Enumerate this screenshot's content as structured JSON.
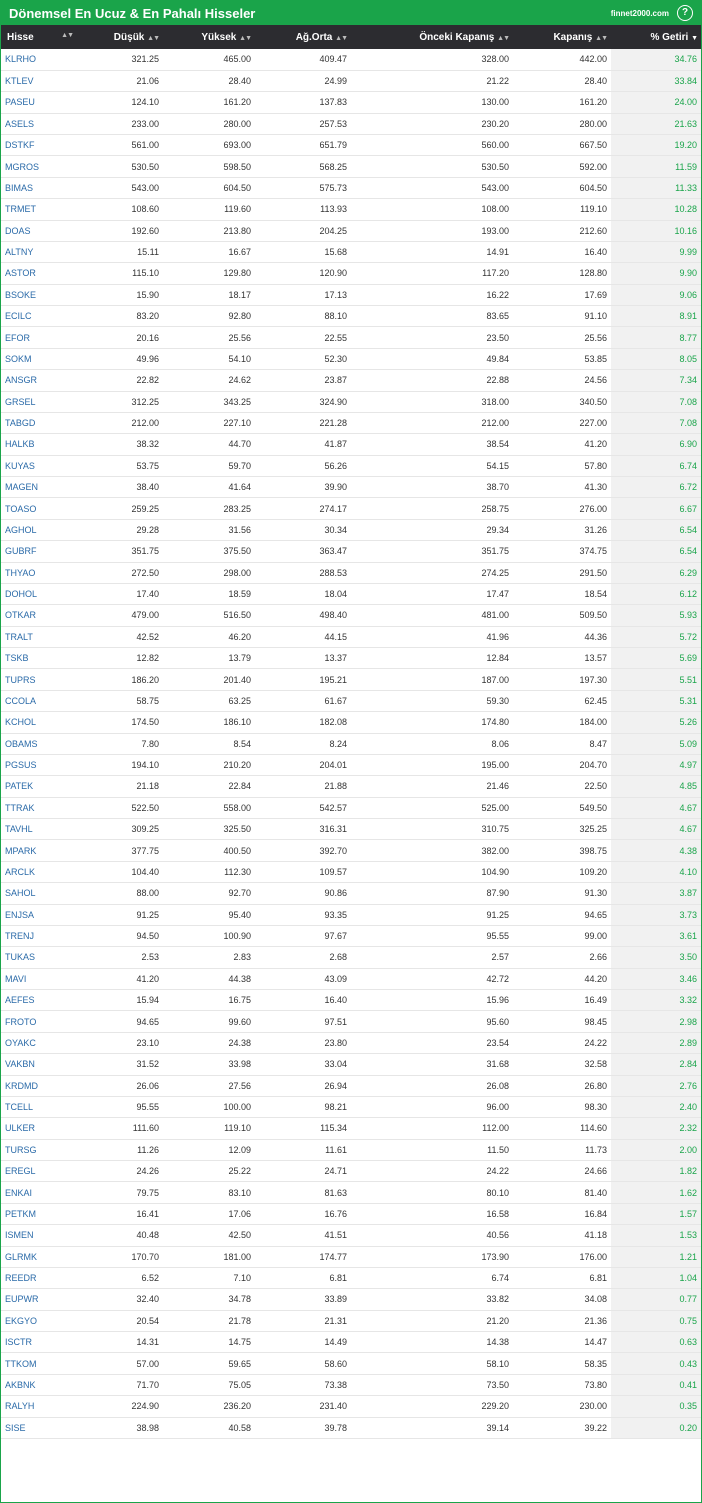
{
  "header": {
    "title": "Dönemsel En Ucuz & En Pahalı Hisseler",
    "brand": "finnet2000.com",
    "help_label": "?"
  },
  "columns": [
    "Hisse",
    "Düşük",
    "Yüksek",
    "Ağ.Orta",
    "Önceki Kapanış",
    "Kapanış",
    "% Getiri"
  ],
  "colors": {
    "accent": "#1aa44a",
    "header_bg": "#2c2c30",
    "link": "#2a6aa8"
  },
  "rows": [
    [
      "KLRHO",
      "321.25",
      "465.00",
      "409.47",
      "328.00",
      "442.00",
      "34.76"
    ],
    [
      "KTLEV",
      "21.06",
      "28.40",
      "24.99",
      "21.22",
      "28.40",
      "33.84"
    ],
    [
      "PASEU",
      "124.10",
      "161.20",
      "137.83",
      "130.00",
      "161.20",
      "24.00"
    ],
    [
      "ASELS",
      "233.00",
      "280.00",
      "257.53",
      "230.20",
      "280.00",
      "21.63"
    ],
    [
      "DSTKF",
      "561.00",
      "693.00",
      "651.79",
      "560.00",
      "667.50",
      "19.20"
    ],
    [
      "MGROS",
      "530.50",
      "598.50",
      "568.25",
      "530.50",
      "592.00",
      "11.59"
    ],
    [
      "BIMAS",
      "543.00",
      "604.50",
      "575.73",
      "543.00",
      "604.50",
      "11.33"
    ],
    [
      "TRMET",
      "108.60",
      "119.60",
      "113.93",
      "108.00",
      "119.10",
      "10.28"
    ],
    [
      "DOAS",
      "192.60",
      "213.80",
      "204.25",
      "193.00",
      "212.60",
      "10.16"
    ],
    [
      "ALTNY",
      "15.11",
      "16.67",
      "15.68",
      "14.91",
      "16.40",
      "9.99"
    ],
    [
      "ASTOR",
      "115.10",
      "129.80",
      "120.90",
      "117.20",
      "128.80",
      "9.90"
    ],
    [
      "BSOKE",
      "15.90",
      "18.17",
      "17.13",
      "16.22",
      "17.69",
      "9.06"
    ],
    [
      "ECILC",
      "83.20",
      "92.80",
      "88.10",
      "83.65",
      "91.10",
      "8.91"
    ],
    [
      "EFOR",
      "20.16",
      "25.56",
      "22.55",
      "23.50",
      "25.56",
      "8.77"
    ],
    [
      "SOKM",
      "49.96",
      "54.10",
      "52.30",
      "49.84",
      "53.85",
      "8.05"
    ],
    [
      "ANSGR",
      "22.82",
      "24.62",
      "23.87",
      "22.88",
      "24.56",
      "7.34"
    ],
    [
      "GRSEL",
      "312.25",
      "343.25",
      "324.90",
      "318.00",
      "340.50",
      "7.08"
    ],
    [
      "TABGD",
      "212.00",
      "227.10",
      "221.28",
      "212.00",
      "227.00",
      "7.08"
    ],
    [
      "HALKB",
      "38.32",
      "44.70",
      "41.87",
      "38.54",
      "41.20",
      "6.90"
    ],
    [
      "KUYAS",
      "53.75",
      "59.70",
      "56.26",
      "54.15",
      "57.80",
      "6.74"
    ],
    [
      "MAGEN",
      "38.40",
      "41.64",
      "39.90",
      "38.70",
      "41.30",
      "6.72"
    ],
    [
      "TOASO",
      "259.25",
      "283.25",
      "274.17",
      "258.75",
      "276.00",
      "6.67"
    ],
    [
      "AGHOL",
      "29.28",
      "31.56",
      "30.34",
      "29.34",
      "31.26",
      "6.54"
    ],
    [
      "GUBRF",
      "351.75",
      "375.50",
      "363.47",
      "351.75",
      "374.75",
      "6.54"
    ],
    [
      "THYAO",
      "272.50",
      "298.00",
      "288.53",
      "274.25",
      "291.50",
      "6.29"
    ],
    [
      "DOHOL",
      "17.40",
      "18.59",
      "18.04",
      "17.47",
      "18.54",
      "6.12"
    ],
    [
      "OTKAR",
      "479.00",
      "516.50",
      "498.40",
      "481.00",
      "509.50",
      "5.93"
    ],
    [
      "TRALT",
      "42.52",
      "46.20",
      "44.15",
      "41.96",
      "44.36",
      "5.72"
    ],
    [
      "TSKB",
      "12.82",
      "13.79",
      "13.37",
      "12.84",
      "13.57",
      "5.69"
    ],
    [
      "TUPRS",
      "186.20",
      "201.40",
      "195.21",
      "187.00",
      "197.30",
      "5.51"
    ],
    [
      "CCOLA",
      "58.75",
      "63.25",
      "61.67",
      "59.30",
      "62.45",
      "5.31"
    ],
    [
      "KCHOL",
      "174.50",
      "186.10",
      "182.08",
      "174.80",
      "184.00",
      "5.26"
    ],
    [
      "OBAMS",
      "7.80",
      "8.54",
      "8.24",
      "8.06",
      "8.47",
      "5.09"
    ],
    [
      "PGSUS",
      "194.10",
      "210.20",
      "204.01",
      "195.00",
      "204.70",
      "4.97"
    ],
    [
      "PATEK",
      "21.18",
      "22.84",
      "21.88",
      "21.46",
      "22.50",
      "4.85"
    ],
    [
      "TTRAK",
      "522.50",
      "558.00",
      "542.57",
      "525.00",
      "549.50",
      "4.67"
    ],
    [
      "TAVHL",
      "309.25",
      "325.50",
      "316.31",
      "310.75",
      "325.25",
      "4.67"
    ],
    [
      "MPARK",
      "377.75",
      "400.50",
      "392.70",
      "382.00",
      "398.75",
      "4.38"
    ],
    [
      "ARCLK",
      "104.40",
      "112.30",
      "109.57",
      "104.90",
      "109.20",
      "4.10"
    ],
    [
      "SAHOL",
      "88.00",
      "92.70",
      "90.86",
      "87.90",
      "91.30",
      "3.87"
    ],
    [
      "ENJSA",
      "91.25",
      "95.40",
      "93.35",
      "91.25",
      "94.65",
      "3.73"
    ],
    [
      "TRENJ",
      "94.50",
      "100.90",
      "97.67",
      "95.55",
      "99.00",
      "3.61"
    ],
    [
      "TUKAS",
      "2.53",
      "2.83",
      "2.68",
      "2.57",
      "2.66",
      "3.50"
    ],
    [
      "MAVI",
      "41.20",
      "44.38",
      "43.09",
      "42.72",
      "44.20",
      "3.46"
    ],
    [
      "AEFES",
      "15.94",
      "16.75",
      "16.40",
      "15.96",
      "16.49",
      "3.32"
    ],
    [
      "FROTO",
      "94.65",
      "99.60",
      "97.51",
      "95.60",
      "98.45",
      "2.98"
    ],
    [
      "OYAKC",
      "23.10",
      "24.38",
      "23.80",
      "23.54",
      "24.22",
      "2.89"
    ],
    [
      "VAKBN",
      "31.52",
      "33.98",
      "33.04",
      "31.68",
      "32.58",
      "2.84"
    ],
    [
      "KRDMD",
      "26.06",
      "27.56",
      "26.94",
      "26.08",
      "26.80",
      "2.76"
    ],
    [
      "TCELL",
      "95.55",
      "100.00",
      "98.21",
      "96.00",
      "98.30",
      "2.40"
    ],
    [
      "ULKER",
      "111.60",
      "119.10",
      "115.34",
      "112.00",
      "114.60",
      "2.32"
    ],
    [
      "TURSG",
      "11.26",
      "12.09",
      "11.61",
      "11.50",
      "11.73",
      "2.00"
    ],
    [
      "EREGL",
      "24.26",
      "25.22",
      "24.71",
      "24.22",
      "24.66",
      "1.82"
    ],
    [
      "ENKAI",
      "79.75",
      "83.10",
      "81.63",
      "80.10",
      "81.40",
      "1.62"
    ],
    [
      "PETKM",
      "16.41",
      "17.06",
      "16.76",
      "16.58",
      "16.84",
      "1.57"
    ],
    [
      "ISMEN",
      "40.48",
      "42.50",
      "41.51",
      "40.56",
      "41.18",
      "1.53"
    ],
    [
      "GLRMK",
      "170.70",
      "181.00",
      "174.77",
      "173.90",
      "176.00",
      "1.21"
    ],
    [
      "REEDR",
      "6.52",
      "7.10",
      "6.81",
      "6.74",
      "6.81",
      "1.04"
    ],
    [
      "EUPWR",
      "32.40",
      "34.78",
      "33.89",
      "33.82",
      "34.08",
      "0.77"
    ],
    [
      "EKGYO",
      "20.54",
      "21.78",
      "21.31",
      "21.20",
      "21.36",
      "0.75"
    ],
    [
      "ISCTR",
      "14.31",
      "14.75",
      "14.49",
      "14.38",
      "14.47",
      "0.63"
    ],
    [
      "TTKOM",
      "57.00",
      "59.65",
      "58.60",
      "58.10",
      "58.35",
      "0.43"
    ],
    [
      "AKBNK",
      "71.70",
      "75.05",
      "73.38",
      "73.50",
      "73.80",
      "0.41"
    ],
    [
      "RALYH",
      "224.90",
      "236.20",
      "231.40",
      "229.20",
      "230.00",
      "0.35"
    ],
    [
      "SISE",
      "38.98",
      "40.58",
      "39.78",
      "39.14",
      "39.22",
      "0.20"
    ]
  ]
}
